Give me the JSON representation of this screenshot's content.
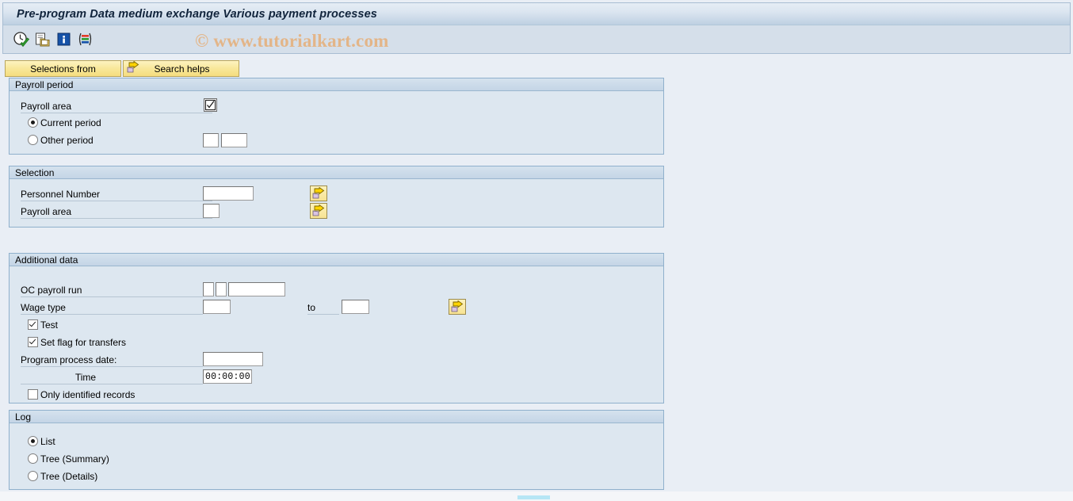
{
  "window": {
    "title": "Pre-program Data medium exchange Various payment processes"
  },
  "toolbar": {
    "icons": [
      {
        "name": "execute-clock-icon",
        "title": "Execute"
      },
      {
        "name": "copy-variant-icon",
        "title": "Get variant"
      },
      {
        "name": "info-icon",
        "title": "Information"
      },
      {
        "name": "layout-variant-icon",
        "title": "Display layout"
      }
    ],
    "watermark": "© www.tutorialkart.com"
  },
  "buttons": {
    "selections_from": "Selections from",
    "search_helps": "Search helps"
  },
  "groups": {
    "payroll_period": {
      "title": "Payroll period",
      "payroll_area_label": "Payroll area",
      "payroll_area_value": "",
      "current_period_label": "Current period",
      "other_period_label": "Other period",
      "other_period_value_1": "",
      "other_period_value_2": "",
      "selected_option": "Current period"
    },
    "selection": {
      "title": "Selection",
      "personnel_number_label": "Personnel Number",
      "personnel_number_value": "",
      "payroll_area_label": "Payroll area",
      "payroll_area_value": ""
    },
    "additional_data": {
      "title": "Additional data",
      "oc_payroll_run_label": "OC payroll run",
      "oc_payroll_run_value_1": "",
      "oc_payroll_run_value_2": "",
      "oc_payroll_run_value_3": "",
      "wage_type_label": "Wage type",
      "wage_type_from_value": "",
      "wage_type_to_label": "to",
      "wage_type_to_value": "",
      "test_label": "Test",
      "test_checked": true,
      "set_flag_label": "Set flag for transfers",
      "set_flag_checked": true,
      "program_process_date_label": "Program process date:",
      "program_process_date_value": "",
      "time_label": "Time",
      "time_value": "00:00:00",
      "only_identified_records_label": "Only identified records",
      "only_identified_records_checked": false
    },
    "log": {
      "title": "Log",
      "list_label": "List",
      "tree_summary_label": "Tree (Summary)",
      "tree_details_label": "Tree (Details)",
      "selected_option": "List"
    }
  },
  "colors": {
    "title_bar_top": "#e6edf5",
    "title_bar_bottom": "#9fb6cc",
    "toolbar_bg": "#d5dfea",
    "page_bg": "#e9eef5",
    "group_bg": "#dde7f0",
    "group_border": "#8fb0cc",
    "button_yellow": "#f5dd7e",
    "watermark": "#e3b588",
    "scrollbar_thumb": "#b6e6f5"
  }
}
